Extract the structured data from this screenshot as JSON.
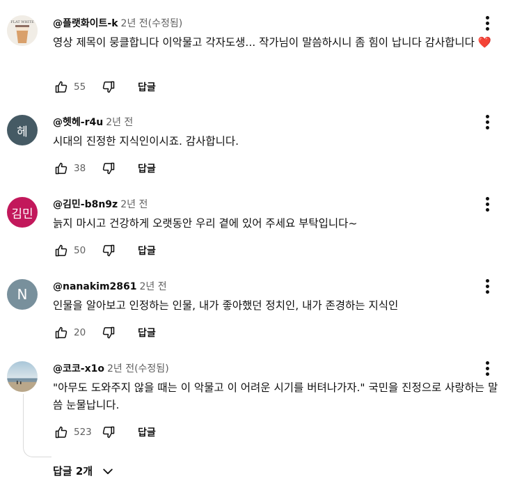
{
  "comments": [
    {
      "author": "@플랫화이트-k",
      "time": "2년 전(수정됨)",
      "text": "영상 제목이 뭉클합니다 이악물고 각자도생... 작가님이 말씀하시니 좀 힘이 납니다 감사합니다",
      "heart": "❤️",
      "likes": "55",
      "avatar_type": "image",
      "avatar_caption": "FLAT WHITE",
      "reply_label": "답글"
    },
    {
      "author": "@헷헤-r4u",
      "time": "2년 전",
      "text": "시대의 진정한 지식인이시죠. 감사합니다.",
      "likes": "38",
      "avatar_type": "initial",
      "avatar_text": "헤",
      "avatar_color": "#455a64",
      "reply_label": "답글"
    },
    {
      "author": "@김민-b8n9z",
      "time": "2년 전",
      "text": "늙지 마시고 건강하게 오랫동안 우리 곁에 있어 주세요 부탁입니다~",
      "likes": "50",
      "avatar_type": "initial",
      "avatar_text": "김민",
      "avatar_color": "#c2185b",
      "reply_label": "답글"
    },
    {
      "author": "@nanakim2861",
      "time": "2년 전",
      "text": "인물을 알아보고 인정하는 인물, 내가 좋아했던 정치인, 내가 존경하는 지식인",
      "likes": "20",
      "avatar_type": "initial",
      "avatar_text": "N",
      "avatar_color": "#78909c",
      "reply_label": "답글"
    },
    {
      "author": "@코코-x1o",
      "time": "2년 전(수정됨)",
      "text": "\"아무도 도와주지 않을 때는 이 악물고 이 어려운 시기를 버텨나가자.\" 국민을 진정으로 사랑하는 말씀 눈물납니다.",
      "likes": "523",
      "avatar_type": "image",
      "reply_label": "답글"
    }
  ],
  "replies_toggle": "답글 2개"
}
